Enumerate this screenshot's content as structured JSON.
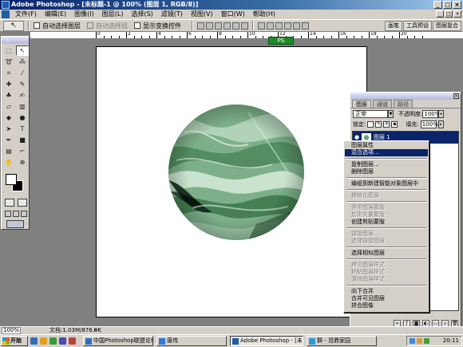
{
  "window": {
    "title": "Adobe Photoshop - [未标题-1 @ 100% (图层 1, RGB/8)]",
    "controls": [
      "_",
      "□",
      "×"
    ]
  },
  "menubar": {
    "items": [
      "文件(F)",
      "编辑(E)",
      "图像(I)",
      "图层(L)",
      "选择(S)",
      "滤镜(T)",
      "视图(V)",
      "窗口(W)",
      "帮助(H)"
    ],
    "mdi_controls": [
      "_",
      "□",
      "×"
    ]
  },
  "options": {
    "auto_select_layer": "自动选择图层",
    "auto_select_group": "自动选择组",
    "show_transform": "显示变换控件",
    "palette_well": [
      "画笔",
      "工具预设",
      "图层复合"
    ]
  },
  "ruler": {
    "numbers": [
      "0",
      "2",
      "4",
      "6",
      "8",
      "10",
      "12",
      "14",
      "16",
      "18",
      "20"
    ]
  },
  "badge": {
    "text": "PS"
  },
  "layers_palette": {
    "tabs": [
      "图层",
      "通道",
      "路径"
    ],
    "blend_mode": "正常",
    "opacity_label": "不透明度:",
    "opacity_value": "100%",
    "lock_label": "锁定:",
    "fill_label": "填充:",
    "fill_value": "100%",
    "layer_name": "图层 1"
  },
  "context_menu": {
    "groups": [
      [
        {
          "label": "图层属性",
          "state": "normal"
        },
        {
          "label": "混合选项...",
          "state": "highlight"
        }
      ],
      [
        {
          "label": "复制图层...",
          "state": "normal"
        },
        {
          "label": "删除图层",
          "state": "normal"
        }
      ],
      [
        {
          "label": "编组到新建智能对象图层中",
          "state": "normal"
        }
      ],
      [
        {
          "label": "栅格化图层",
          "state": "disabled"
        }
      ],
      [
        {
          "label": "停用图层蒙版",
          "state": "disabled"
        },
        {
          "label": "启用矢量蒙版",
          "state": "disabled"
        },
        {
          "label": "创建剪贴蒙版",
          "state": "normal"
        }
      ],
      [
        {
          "label": "链接图层",
          "state": "disabled"
        },
        {
          "label": "选择链接图层",
          "state": "disabled"
        }
      ],
      [
        {
          "label": "选择相似图层",
          "state": "normal"
        }
      ],
      [
        {
          "label": "拷贝图层样式",
          "state": "disabled"
        },
        {
          "label": "粘贴图层样式",
          "state": "disabled"
        },
        {
          "label": "清除图层样式",
          "state": "disabled"
        }
      ],
      [
        {
          "label": "向下合并",
          "state": "normal"
        },
        {
          "label": "合并可见图层",
          "state": "normal"
        },
        {
          "label": "拼合图像",
          "state": "normal"
        }
      ]
    ]
  },
  "status": {
    "zoom": "100%",
    "doc_info": "文档:1.03M/876.9K"
  },
  "taskbar": {
    "start_label": "开始",
    "tasks": [
      "中国Photoshop联盟论坛...",
      "唐伟",
      "Adobe Photoshop - [未标...",
      "群 - 觅鼎家园"
    ],
    "clock": "20:11"
  },
  "colors": {
    "title_start": "#0a246a",
    "title_end": "#a6caf0",
    "chrome": "#d4d0c8",
    "workspace": "#808080",
    "highlight": "#0a246a",
    "marble_base": "#7fb08c",
    "marble_dark": "#1e3d25",
    "badge": "#1f8c2b"
  }
}
